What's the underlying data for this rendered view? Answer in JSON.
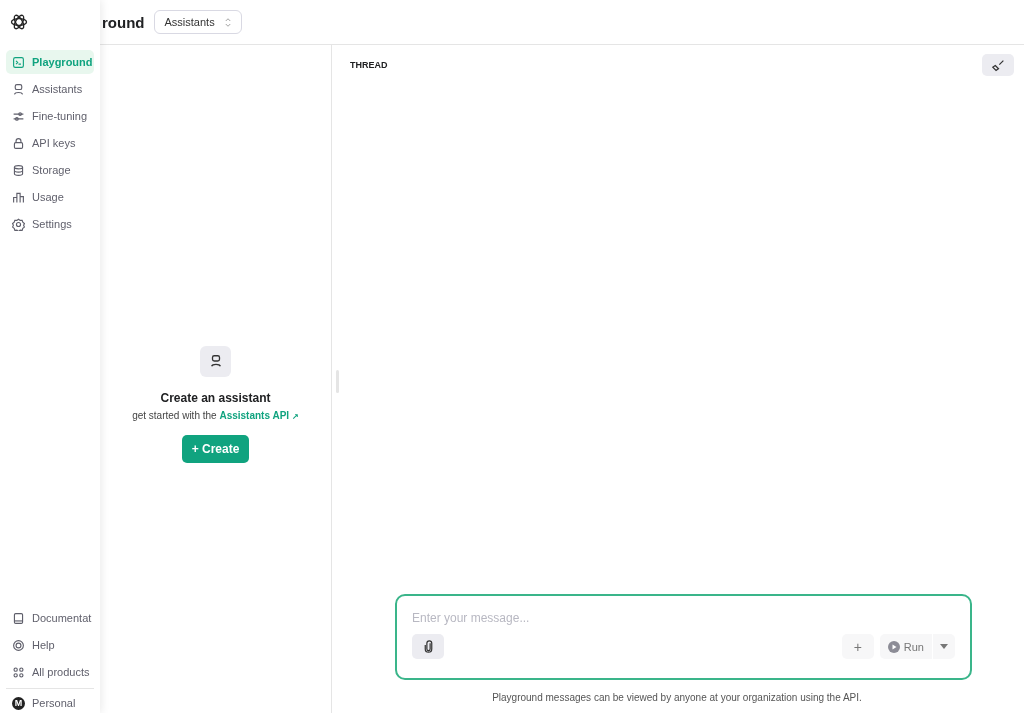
{
  "header": {
    "title": "round",
    "selector": "Assistants"
  },
  "sidebar": {
    "items": [
      {
        "label": "Playground",
        "selected": true
      },
      {
        "label": "Assistants",
        "selected": false
      },
      {
        "label": "Fine-tuning",
        "selected": false
      },
      {
        "label": "API keys",
        "selected": false
      },
      {
        "label": "Storage",
        "selected": false
      },
      {
        "label": "Usage",
        "selected": false
      },
      {
        "label": "Settings",
        "selected": false
      }
    ],
    "footer_items": [
      {
        "label": "Documentat"
      },
      {
        "label": "Help"
      },
      {
        "label": "All products"
      }
    ],
    "account": {
      "avatar": "M",
      "label": "Personal"
    }
  },
  "assistants_panel": {
    "heading": "Create an assistant",
    "text": "get started with the",
    "link": "Assistants API",
    "link_mark": "↗",
    "button": "+ Create"
  },
  "thread": {
    "label": "THREAD",
    "composer": {
      "placeholder": "Enter your message...",
      "add": "+",
      "run": "Run"
    },
    "notice": "Playground messages can be viewed by anyone at your organization using the API."
  }
}
